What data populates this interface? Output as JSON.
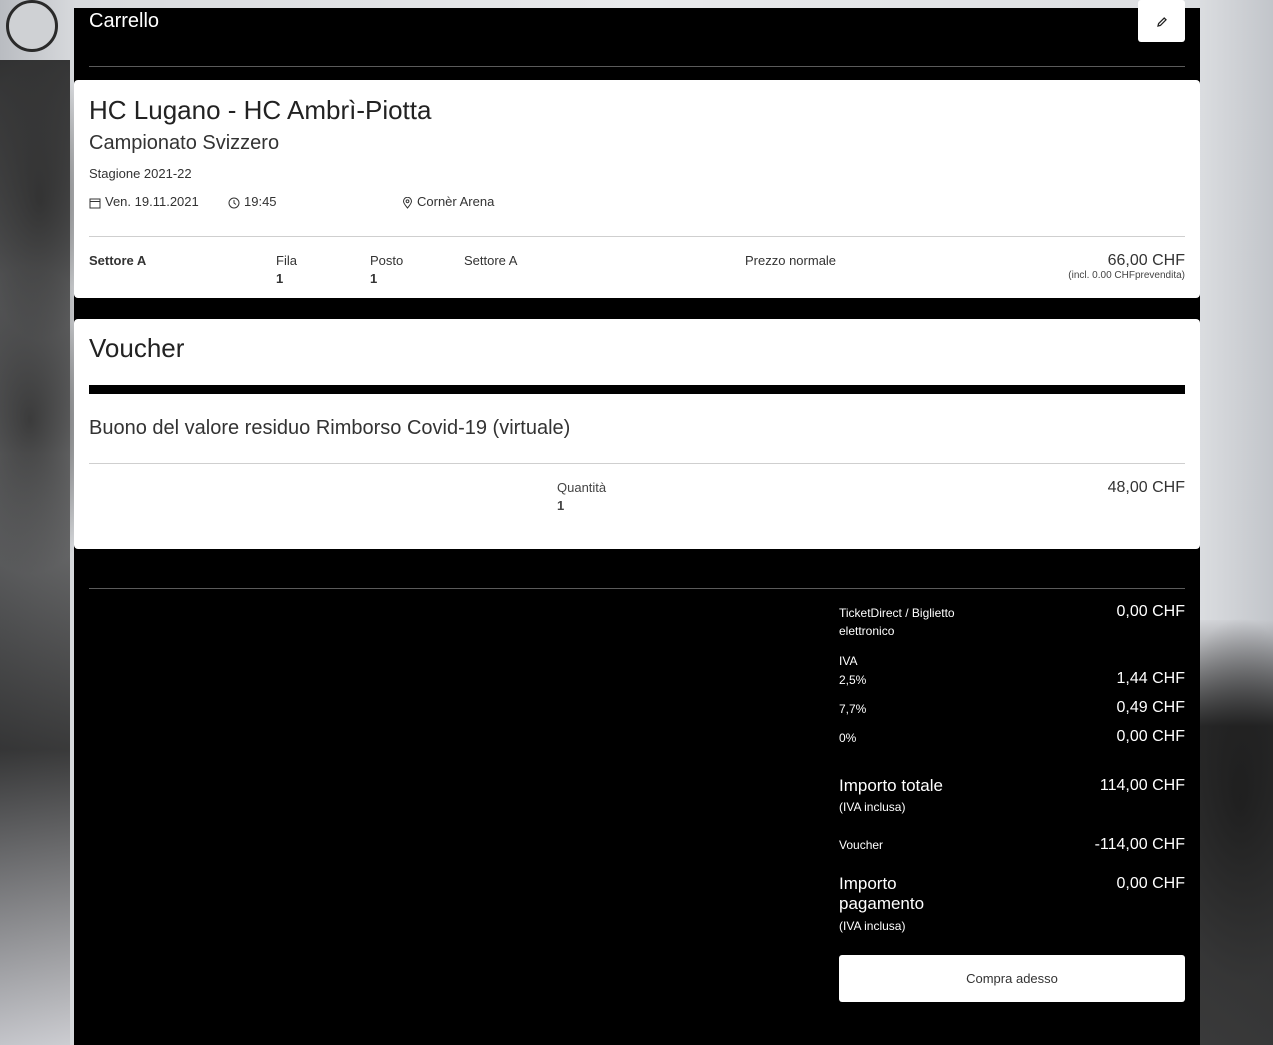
{
  "header": {
    "cart_title": "Carrello",
    "edit_icon": "pencil-icon"
  },
  "event": {
    "title": "HC Lugano - HC Ambrì-Piotta",
    "competition": "Campionato Svizzero",
    "season": "Stagione 2021-22",
    "date": "Ven. 19.11.2021",
    "time": "19:45",
    "venue": "Cornèr Arena",
    "icons": {
      "date": "calendar-icon",
      "time": "clock-icon",
      "venue": "location-pin-icon"
    },
    "ticket": {
      "sector": "Settore A",
      "row_label": "Fila",
      "row_value": "1",
      "seat_label": "Posto",
      "seat_value": "1",
      "sector_repeat": "Settore A",
      "price_type": "Prezzo normale",
      "price": "66,00 CHF",
      "price_note": "(incl. 0.00 CHFprevendita)"
    }
  },
  "voucher": {
    "title": "Voucher",
    "name": "Buono del valore residuo Rimborso Covid-19 (virtuale)",
    "qty_label": "Quantità",
    "qty_value": "1",
    "price": "48,00 CHF"
  },
  "summary": {
    "delivery_label": "TicketDirect / Biglietto elettronico",
    "delivery_value": "0,00 CHF",
    "iva_label": "IVA",
    "iva_rows": [
      {
        "rate": "2,5%",
        "value": "1,44 CHF"
      },
      {
        "rate": "7,7%",
        "value": "0,49 CHF"
      },
      {
        "rate": "0%",
        "value": "0,00 CHF"
      }
    ],
    "total_label": "Importo totale",
    "total_note": "(IVA inclusa)",
    "total_value": "114,00 CHF",
    "voucher_label": "Voucher",
    "voucher_value": "-114,00 CHF",
    "payment_label": "Importo pagamento",
    "payment_note": "(IVA inclusa)",
    "payment_value": "0,00 CHF",
    "buy_label": "Compra adesso"
  }
}
